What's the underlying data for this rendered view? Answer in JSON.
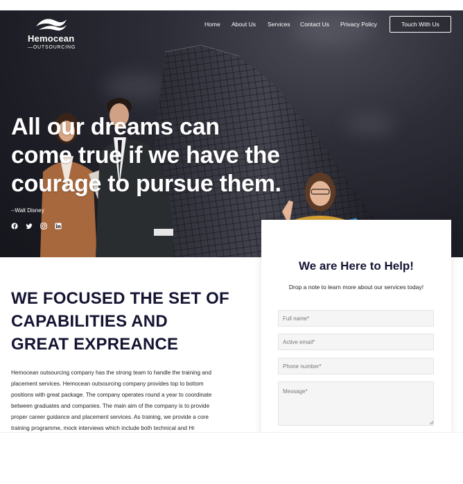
{
  "brand": {
    "name": "Hemocean",
    "tagline": "OUTSOURCING"
  },
  "nav": {
    "items": [
      "Home",
      "About Us",
      "Services",
      "Contact Us",
      "Privacy Policy"
    ],
    "cta_label": "Touch With Us"
  },
  "hero": {
    "quote_lines": [
      "All our dreams can",
      "come true if we have the",
      "courage to pursue them."
    ],
    "author": "--Walt Disney",
    "social_icons": [
      "facebook-icon",
      "twitter-icon",
      "instagram-icon",
      "linkedin-icon"
    ]
  },
  "features": {
    "title_lines": [
      "WE FOCUSED THE SET OF",
      "CAPABILITIES AND",
      "GREAT EXPREANCE"
    ],
    "description": "Hemocean outsourcing company has the strong team to handle the training and placement services. Hemocean outsourcing company provides top to bottom positions with great package. The company operates round a year to coordinate between graduates and companies. The main aim of the company is to provide proper career guidance and placement services. As training, we provide a core training programme, mock interviews which include both technical and Hr"
  },
  "contact_form": {
    "title": "We are Here to Help!",
    "subtitle": "Drop a note to learn more about our services today!",
    "full_name_placeholder": "Full name*",
    "email_placeholder": "Active email*",
    "phone_placeholder": "Phone number*",
    "message_placeholder": "Message*"
  },
  "colors": {
    "heading": "#141433",
    "hero_bg": "#1d1d26",
    "field_bg": "#f5f5f5"
  }
}
